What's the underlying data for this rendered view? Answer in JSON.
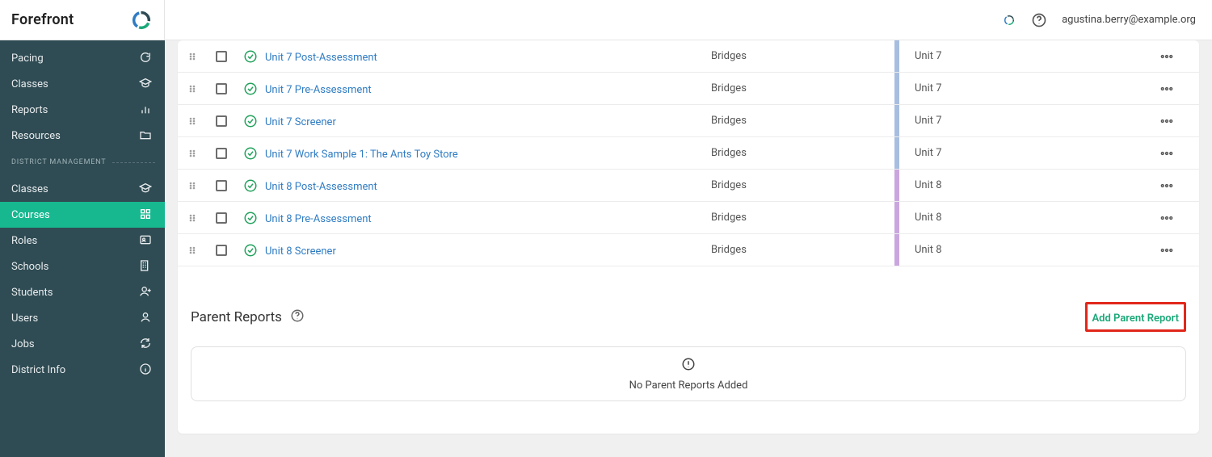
{
  "brand": "Forefront",
  "user_email": "agustina.berry@example.org",
  "sidebar": {
    "management_label": "DISTRICT MANAGEMENT",
    "primary": [
      {
        "label": "Pacing",
        "icon": "refresh"
      },
      {
        "label": "Classes",
        "icon": "grad-cap"
      },
      {
        "label": "Reports",
        "icon": "bar-chart"
      },
      {
        "label": "Resources",
        "icon": "folder"
      }
    ],
    "management": [
      {
        "label": "Classes",
        "icon": "grad-cap",
        "active": false
      },
      {
        "label": "Courses",
        "icon": "grid",
        "active": true
      },
      {
        "label": "Roles",
        "icon": "id-card",
        "active": false
      },
      {
        "label": "Schools",
        "icon": "building",
        "active": false
      },
      {
        "label": "Students",
        "icon": "user-plus",
        "active": false
      },
      {
        "label": "Users",
        "icon": "user",
        "active": false
      },
      {
        "label": "Jobs",
        "icon": "sync",
        "active": false
      },
      {
        "label": "District Info",
        "icon": "info",
        "active": false
      }
    ]
  },
  "rows": [
    {
      "title": "Unit 7 Post-Assessment",
      "source": "Bridges",
      "unit": "Unit 7",
      "stripe": "blue"
    },
    {
      "title": "Unit 7 Pre-Assessment",
      "source": "Bridges",
      "unit": "Unit 7",
      "stripe": "blue"
    },
    {
      "title": "Unit 7 Screener",
      "source": "Bridges",
      "unit": "Unit 7",
      "stripe": "blue"
    },
    {
      "title": "Unit 7 Work Sample 1: The Ants Toy Store",
      "source": "Bridges",
      "unit": "Unit 7",
      "stripe": "blue"
    },
    {
      "title": "Unit 8 Post-Assessment",
      "source": "Bridges",
      "unit": "Unit 8",
      "stripe": "purple"
    },
    {
      "title": "Unit 8 Pre-Assessment",
      "source": "Bridges",
      "unit": "Unit 8",
      "stripe": "purple"
    },
    {
      "title": "Unit 8 Screener",
      "source": "Bridges",
      "unit": "Unit 8",
      "stripe": "purple"
    }
  ],
  "parent_reports": {
    "title": "Parent Reports",
    "add_label": "Add Parent Report",
    "empty_message": "No Parent Reports Added"
  }
}
